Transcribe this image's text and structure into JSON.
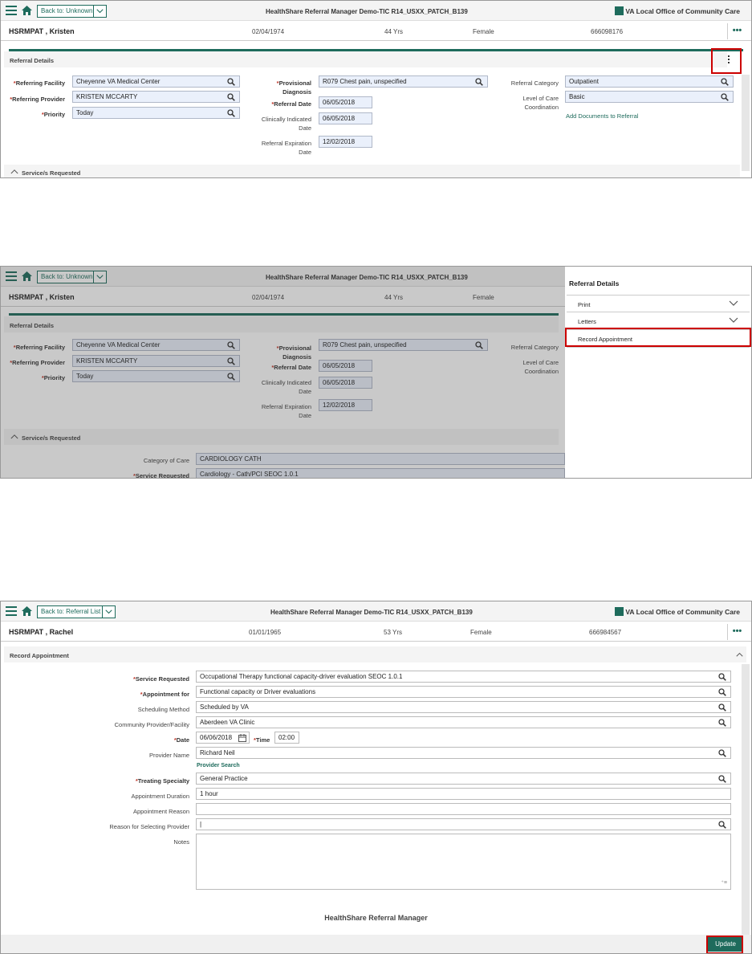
{
  "app": {
    "title": "HealthShare Referral Manager Demo-TIC R14_USXX_PATCH_B139",
    "office": "VA Local Office of Community Care",
    "footer_title": "HealthShare Referral Manager"
  },
  "colors": {
    "brand": "#1e6b5c",
    "highlight": "#cc0000",
    "required": "#c0392b"
  },
  "screen1": {
    "back_label": "Back to: Unknown",
    "patient": {
      "name": "HSRMPAT , Kristen",
      "dob": "02/04/1974",
      "age": "44 Yrs",
      "sex": "Female",
      "id": "666098176"
    },
    "section_title": "Referral Details",
    "labels": {
      "referring_facility": "Referring Facility",
      "referring_provider": "Referring Provider",
      "priority": "Priority",
      "provisional": "Provisional",
      "diagnosis": "Diagnosis",
      "referral_date": "Referral Date",
      "clinically_indicated": "Clinically Indicated",
      "date": "Date",
      "referral_expiration": "Referral Expiration",
      "referral_category": "Referral Category",
      "level_of_care": "Level of Care",
      "coordination": "Coordination"
    },
    "values": {
      "referring_facility": "Cheyenne VA Medical Center",
      "referring_provider": "KRISTEN MCCARTY",
      "priority": "Today",
      "provisional_diagnosis": "R079 Chest pain, unspecified",
      "referral_date": "06/05/2018",
      "clinically_indicated_date": "06/05/2018",
      "referral_expiration_date": "12/02/2018",
      "referral_category": "Outpatient",
      "level_of_care": "Basic"
    },
    "add_documents_link": "Add Documents to Referral",
    "services_section": "Service/s Requested"
  },
  "screen2": {
    "drawer_title": "Referral Details",
    "drawer_items": [
      "Print",
      "Letters",
      "Record Appointment"
    ],
    "category_of_care_label": "Category of Care",
    "category_of_care_value": "CARDIOLOGY CATH",
    "service_requested_label": "Service Requested",
    "service_requested_value": "Cardiology - Cath/PCI SEOC 1.0.1"
  },
  "screen3": {
    "back_label": "Back to: Referral List",
    "patient": {
      "name": "HSRMPAT , Rachel",
      "dob": "01/01/1965",
      "age": "53 Yrs",
      "sex": "Female",
      "id": "666984567"
    },
    "section_title": "Record Appointment",
    "labels": {
      "service_requested": "Service Requested",
      "appointment_for": "Appointment for",
      "scheduling_method": "Scheduling Method",
      "community_provider": "Community Provider/Facility",
      "date": "Date",
      "time": "Time",
      "provider_name": "Provider Name",
      "treating_specialty": "Treating Specialty",
      "appointment_duration": "Appointment Duration",
      "appointment_reason": "Appointment Reason",
      "reason_selecting": "Reason for Selecting Provider",
      "notes": "Notes"
    },
    "values": {
      "service_requested": "Occupational Therapy functional capacity-driver evaluation SEOC 1.0.1",
      "appointment_for": "Functional capacity or Driver evaluations",
      "scheduling_method": "Scheduled by VA",
      "community_provider": "Aberdeen VA Clinic",
      "date": "06/06/2018",
      "time": "02:00",
      "provider_name": "Richard Neil",
      "treating_specialty": "General Practice",
      "appointment_duration": "1 hour",
      "appointment_reason": "",
      "reason_selecting": "|",
      "notes": ""
    },
    "provider_search_link": "Provider Search",
    "update_label": "Update"
  }
}
